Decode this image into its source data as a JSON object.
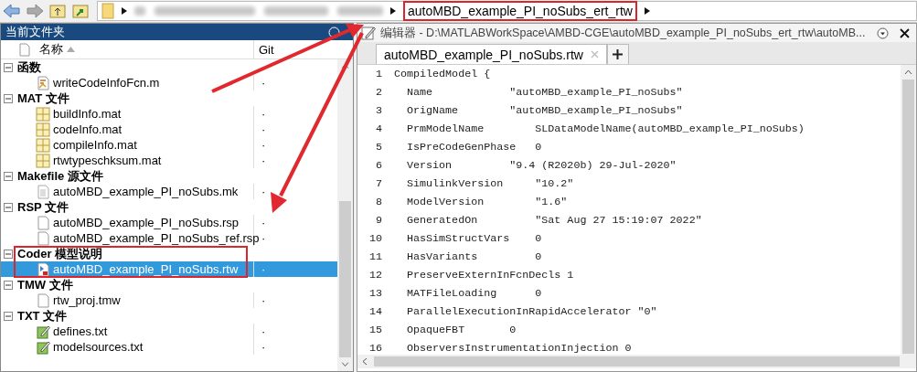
{
  "breadcrumb": {
    "current": "autoMBD_example_PI_noSubs_ert_rtw",
    "highlighted": true
  },
  "file_browser": {
    "title": "当前文件夹",
    "columns": [
      {
        "label": "名称",
        "sorted": true
      },
      {
        "label": "Git",
        "sorted": false
      }
    ],
    "groups": [
      {
        "label": "函数",
        "expanded": true,
        "highlighted": false,
        "items": [
          {
            "name": "writeCodeInfoFcn.m",
            "kind": "function",
            "git": "·",
            "selected": false
          }
        ]
      },
      {
        "label": "MAT 文件",
        "expanded": true,
        "highlighted": false,
        "items": [
          {
            "name": "buildInfo.mat",
            "kind": "mat",
            "git": "·",
            "selected": false
          },
          {
            "name": "codeInfo.mat",
            "kind": "mat",
            "git": "·",
            "selected": false
          },
          {
            "name": "compileInfo.mat",
            "kind": "mat",
            "git": "·",
            "selected": false
          },
          {
            "name": "rtwtypeschksum.mat",
            "kind": "mat",
            "git": "·",
            "selected": false
          }
        ]
      },
      {
        "label": "Makefile 源文件",
        "expanded": true,
        "highlighted": false,
        "items": [
          {
            "name": "autoMBD_example_PI_noSubs.mk",
            "kind": "text",
            "git": "·",
            "selected": false
          }
        ]
      },
      {
        "label": "RSP 文件",
        "expanded": true,
        "highlighted": false,
        "items": [
          {
            "name": "autoMBD_example_PI_noSubs.rsp",
            "kind": "blank",
            "git": "·",
            "selected": false
          },
          {
            "name": "autoMBD_example_PI_noSubs_ref.rsp",
            "kind": "blank",
            "git": "·",
            "selected": false
          }
        ]
      },
      {
        "label": "Coder 模型说明",
        "expanded": true,
        "highlighted": true,
        "items": [
          {
            "name": "autoMBD_example_PI_noSubs.rtw",
            "kind": "model",
            "git": "·",
            "selected": true
          }
        ]
      },
      {
        "label": "TMW 文件",
        "expanded": true,
        "highlighted": false,
        "items": [
          {
            "name": "rtw_proj.tmw",
            "kind": "blank",
            "git": "·",
            "selected": false
          }
        ]
      },
      {
        "label": "TXT 文件",
        "expanded": true,
        "highlighted": false,
        "items": [
          {
            "name": "defines.txt",
            "kind": "txt",
            "git": "·",
            "selected": false
          },
          {
            "name": "modelsources.txt",
            "kind": "txt",
            "git": "·",
            "selected": false
          }
        ]
      }
    ]
  },
  "editor": {
    "title": "编辑器 - D:\\MATLABWorkSpace\\AMBD-CGE\\autoMBD_example_PI_noSubs_ert_rtw\\autoMB...",
    "tabs": [
      {
        "label": "autoMBD_example_PI_noSubs.rtw",
        "selected": true
      }
    ],
    "lines": [
      {
        "number": "1",
        "text": "CompiledModel {"
      },
      {
        "number": "2",
        "text": "  Name            \"autoMBD_example_PI_noSubs\""
      },
      {
        "number": "3",
        "text": "  OrigName        \"autoMBD_example_PI_noSubs\""
      },
      {
        "number": "4",
        "text": "  PrmModelName        SLDataModelName(autoMBD_example_PI_noSubs)"
      },
      {
        "number": "5",
        "text": "  IsPreCodeGenPhase   0"
      },
      {
        "number": "6",
        "text": "  Version         \"9.4 (R2020b) 29-Jul-2020\""
      },
      {
        "number": "7",
        "text": "  SimulinkVersion     \"10.2\""
      },
      {
        "number": "8",
        "text": "  ModelVersion        \"1.6\""
      },
      {
        "number": "9",
        "text": "  GeneratedOn         \"Sat Aug 27 15:19:07 2022\""
      },
      {
        "number": "10",
        "text": "  HasSimStructVars    0"
      },
      {
        "number": "11",
        "text": "  HasVariants         0"
      },
      {
        "number": "12",
        "text": "  PreserveExternInFcnDecls 1"
      },
      {
        "number": "13",
        "text": "  MATFileLoading      0"
      },
      {
        "number": "14",
        "text": "  ParallelExecutionInRapidAccelerator \"0\""
      },
      {
        "number": "15",
        "text": "  OpaqueFBT       0"
      },
      {
        "number": "16",
        "text": "  ObserversInstrumentationInjection 0"
      }
    ]
  }
}
